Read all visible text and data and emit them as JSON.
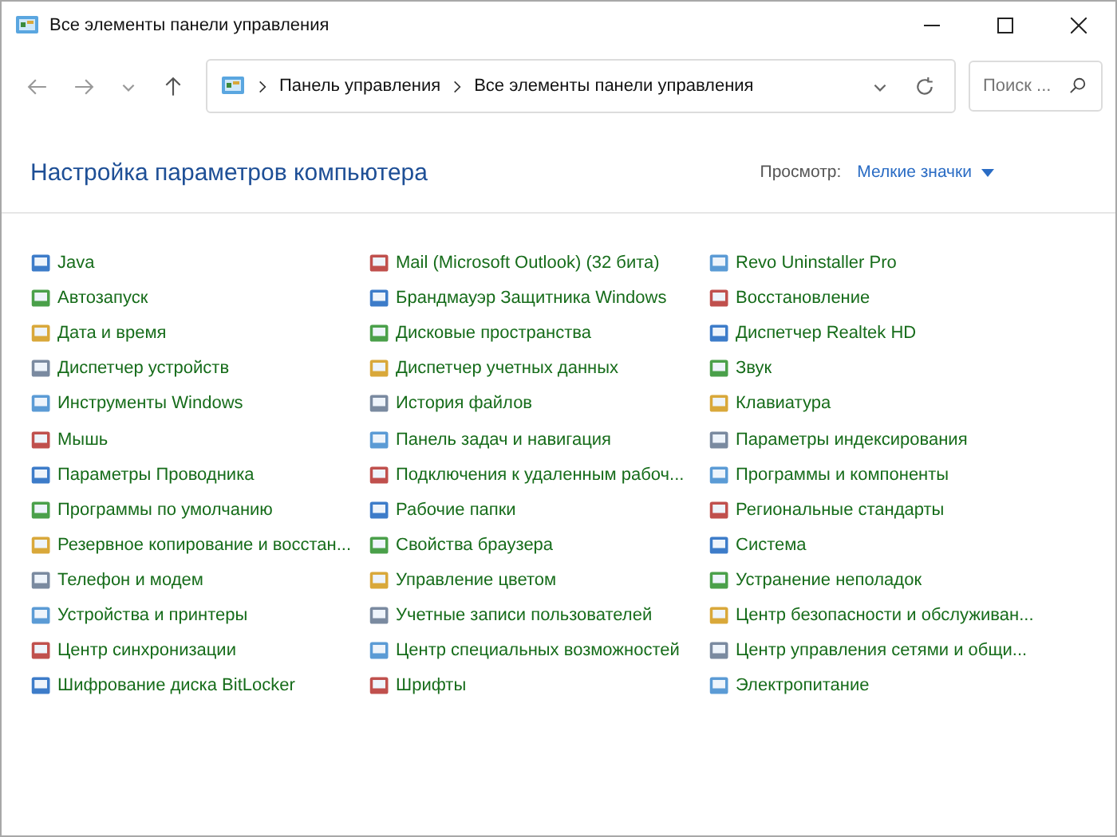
{
  "window": {
    "title": "Все элементы панели управления"
  },
  "address_bar": {
    "breadcrumbs": [
      "Панель управления",
      "Все элементы панели управления"
    ]
  },
  "search": {
    "placeholder": "Поиск ..."
  },
  "header": {
    "title": "Настройка параметров компьютера",
    "view_label": "Просмотр:",
    "view_value": "Мелкие значки"
  },
  "columns": [
    [
      "Java",
      "Автозапуск",
      "Дата и время",
      "Диспетчер устройств",
      "Инструменты Windows",
      "Мышь",
      "Параметры Проводника",
      "Программы по умолчанию",
      "Резервное копирование и восстан...",
      "Телефон и модем",
      "Устройства и принтеры",
      "Центр синхронизации",
      "Шифрование диска BitLocker"
    ],
    [
      "Mail (Microsoft Outlook) (32 бита)",
      "Брандмауэр Защитника Windows",
      "Дисковые пространства",
      "Диспетчер учетных данных",
      "История файлов",
      "Панель задач и навигация",
      "Подключения к удаленным рабоч...",
      "Рабочие папки",
      "Свойства браузера",
      "Управление цветом",
      "Учетные записи пользователей",
      "Центр специальных возможностей",
      "Шрифты"
    ],
    [
      "Revo Uninstaller Pro",
      "Восстановление",
      "Диспетчер Realtek HD",
      "Звук",
      "Клавиатура",
      "Параметры индексирования",
      "Программы и компоненты",
      "Региональные стандарты",
      "Система",
      "Устранение неполадок",
      "Центр безопасности и обслуживан...",
      "Центр управления сетями и общи...",
      "Электропитание"
    ]
  ]
}
